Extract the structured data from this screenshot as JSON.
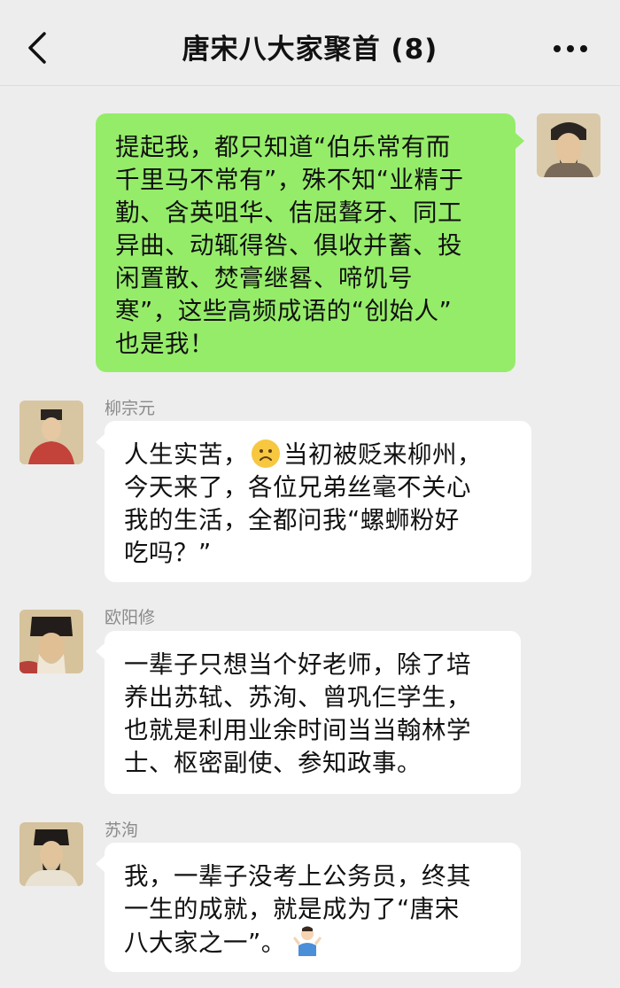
{
  "header": {
    "title": "唐宋八大家聚首 (8)"
  },
  "messages": [
    {
      "sender": "",
      "side": "right",
      "lines": [
        "提起我，都只知道“伯乐常有而",
        "千里马不常有”，殊不知“业精于",
        "勤、含英咀华、佶屈聱牙、同工",
        "异曲、动辄得咎、俱收并蓄、投",
        "闲置散、焚膏继晷、啼饥号",
        "寒”，这些高频成语的“创始人”",
        "也是我！"
      ]
    },
    {
      "sender": "柳宗元",
      "side": "left",
      "lines": [
        "人生实苦，",
        "当初被贬来柳州，",
        "今天来了，各位兄弟丝毫不关心",
        "我的生活，全都问我“螺蛳粉好",
        "吃吗？”"
      ]
    },
    {
      "sender": "欧阳修",
      "side": "left",
      "lines": [
        "一辈子只想当个好老师，除了培",
        "养出苏轼、苏洵、曾巩仨学生，",
        "也就是利用业余时间当当翰林学",
        "士、枢密副使、参知政事。"
      ]
    },
    {
      "sender": "苏洵",
      "side": "left",
      "lines": [
        "我，一辈子没考上公务员，终其",
        "一生的成就，就是成为了“唐宋",
        "八大家之一”。"
      ]
    }
  ],
  "colors": {
    "mine_bubble": "#95ec69",
    "their_bubble": "#ffffff",
    "background": "#ededed"
  },
  "icons": [
    "back-arrow-icon",
    "more-dots-icon",
    "sad-face-emoji",
    "shrug-emoji"
  ]
}
